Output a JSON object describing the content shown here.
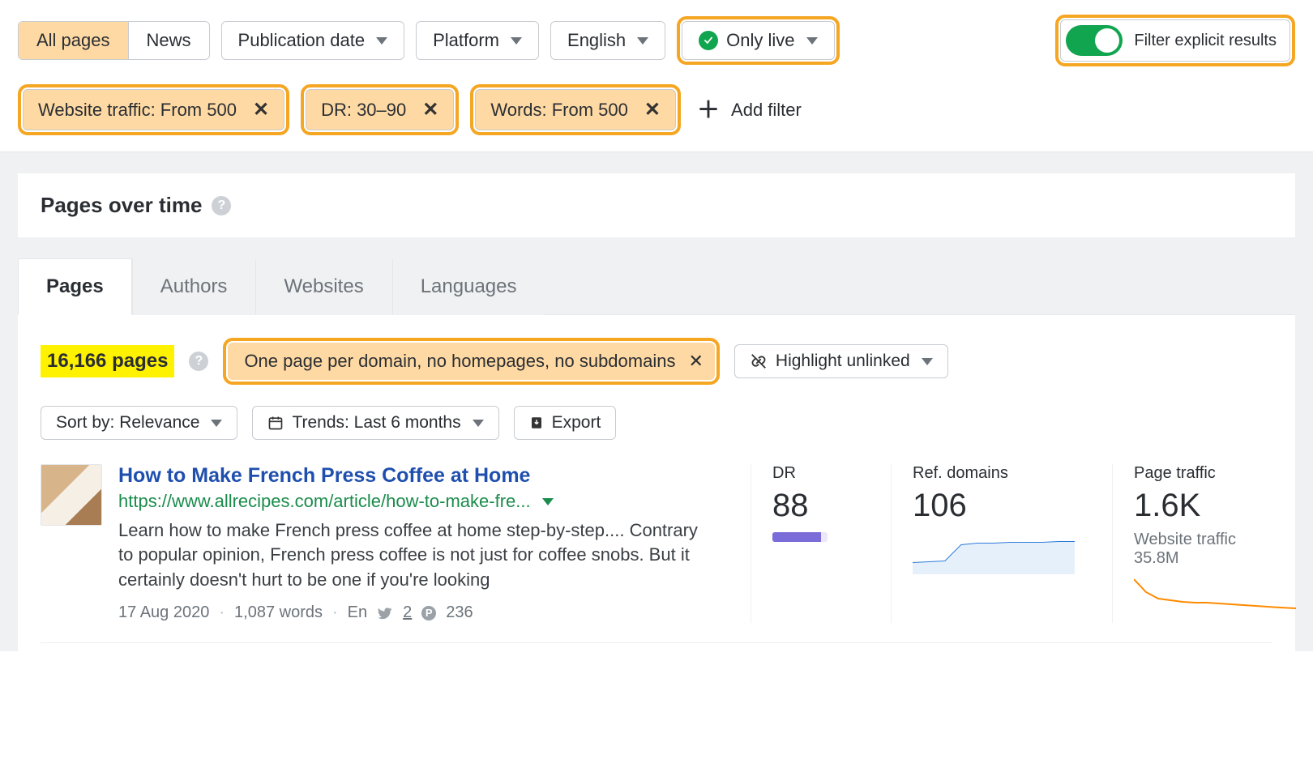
{
  "filters": {
    "segments": [
      "All pages",
      "News"
    ],
    "segment_active": 0,
    "pubdate_label": "Publication date",
    "platform_label": "Platform",
    "language_label": "English",
    "onlylive_label": "Only live",
    "explicit_label": "Filter explicit results",
    "active_chips": [
      "Website traffic: From 500",
      "DR: 30–90",
      "Words: From 500"
    ],
    "add_filter_label": "Add filter"
  },
  "pages_over_time": {
    "title": "Pages over time"
  },
  "tabs": [
    "Pages",
    "Authors",
    "Websites",
    "Languages"
  ],
  "tab_active": 0,
  "results_header": {
    "count_label": "16,166 pages",
    "domain_filter_label": "One page per domain, no homepages, no subdomains",
    "highlight_label": "Highlight unlinked",
    "sort_label": "Sort by: Relevance",
    "trends_label": "Trends: Last 6 months",
    "export_label": "Export"
  },
  "result": {
    "title": "How to Make French Press Coffee at Home",
    "url": "https://www.allrecipes.com/article/how-to-make-fre...",
    "description": "Learn how to make French press coffee at home step-by-step.... Contrary to popular opinion, French press coffee is not just for coffee snobs. But it certainly doesn't hurt to be one if you're looking",
    "date": "17 Aug 2020",
    "words": "1,087 words",
    "lang": "En",
    "twitter_count": "2",
    "pinterest_count": "236",
    "metrics": {
      "dr_label": "DR",
      "dr_value": "88",
      "ref_label": "Ref. domains",
      "ref_value": "106",
      "traffic_label": "Page traffic",
      "traffic_value": "1.6K",
      "site_traffic_label": "Website traffic",
      "site_traffic_value": "35.8M"
    }
  },
  "chart_data": [
    {
      "type": "line",
      "series_name": "Ref. domains trend",
      "values": [
        62,
        64,
        66,
        95,
        98,
        99,
        100,
        101,
        102,
        103,
        104,
        106
      ],
      "color": "#2d7bd8"
    },
    {
      "type": "line",
      "series_name": "Page traffic trend",
      "values": [
        1600,
        1100,
        950,
        900,
        850,
        820,
        800,
        790,
        780,
        760,
        740,
        720
      ],
      "color": "#ff8a00"
    }
  ]
}
